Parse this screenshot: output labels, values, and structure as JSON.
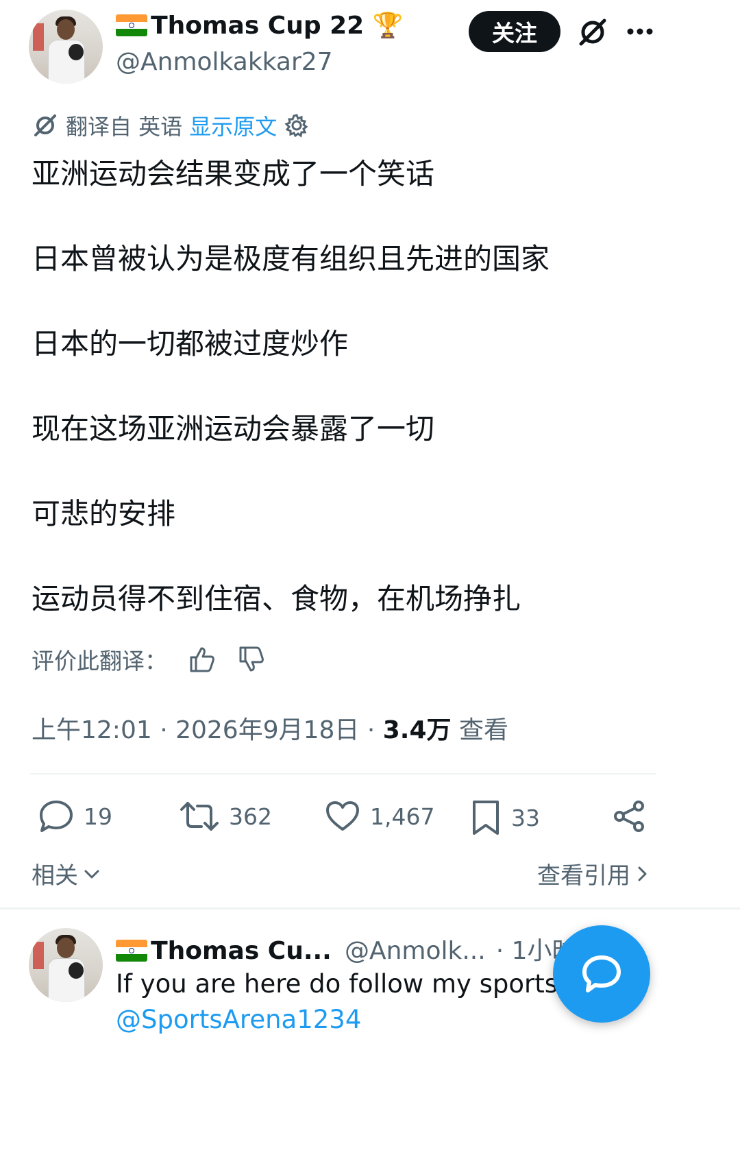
{
  "tweet": {
    "author_name": "Thomas Cup 22 🏆",
    "author_handle": "@Anmolkakkar27",
    "follow_label": "关注",
    "translate": {
      "label": "翻译自 英语",
      "show_original": "显示原文"
    },
    "lines": [
      "亚洲运动会结果变成了一个笑话",
      "日本曾被认为是极度有组织且先进的国家",
      "日本的一切都被过度炒作",
      "现在这场亚洲运动会暴露了一切",
      "可悲的安排",
      "运动员得不到住宿、食物，在机场挣扎"
    ],
    "rate_translation": "评价此翻译：",
    "timestamp": "上午12:01 · 2026年9月18日 · ",
    "views_count": "3.4万",
    "views_label": " 查看",
    "actions": {
      "replies": "19",
      "retweets": "362",
      "likes": "1,467",
      "bookmarks": "33"
    },
    "related_label": "相关",
    "view_quotes_label": "查看引用"
  },
  "reply": {
    "author_name": "Thomas Cu...",
    "author_handle": "@Anmolk...",
    "time": "· 1小时",
    "text": "If you are here do follow my sports pa",
    "mention": "@SportsArena1234"
  },
  "colors": {
    "accent": "#1d9bf0",
    "text": "#0f1419",
    "muted": "#536471",
    "divider": "#eff3f4",
    "follow_bg": "#0f1419"
  },
  "icons": [
    "grok-icon",
    "more-icon",
    "translate-icon",
    "gear-icon",
    "thumbs-up-icon",
    "thumbs-down-icon",
    "reply-icon",
    "retweet-icon",
    "like-icon",
    "bookmark-icon",
    "share-icon",
    "chevron-down-icon",
    "chevron-right-icon",
    "compose-message-icon"
  ]
}
